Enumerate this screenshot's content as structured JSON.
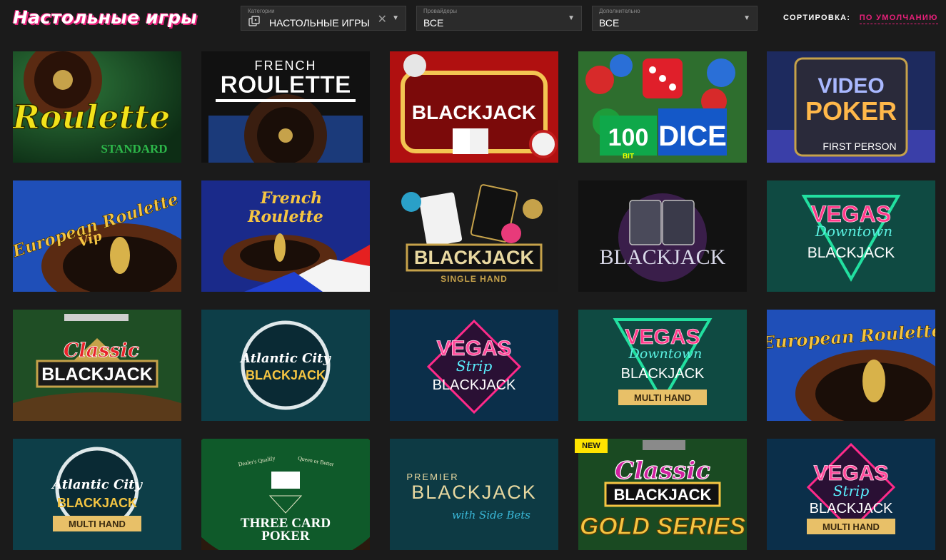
{
  "header": {
    "title": "Настольные игры",
    "filters": {
      "category": {
        "label": "Категории",
        "value": "НАСТОЛЬНЫЕ ИГРЫ",
        "icon": "table-game-icon"
      },
      "provider": {
        "label": "Провайдеры",
        "value": "ВСЕ"
      },
      "extra": {
        "label": "Дополнительно",
        "value": "ВСЕ"
      }
    },
    "sort": {
      "label": "СОРТИРОВКА:",
      "value": "ПО УМОЛЧАНИЮ"
    }
  },
  "games": [
    {
      "t1": "Roulette",
      "t2": "STANDARD"
    },
    {
      "t1": "FRENCH",
      "t2": "ROULETTE"
    },
    {
      "t1": "BLACKJACK",
      "t2": ""
    },
    {
      "t1": "100",
      "t2": "DICE",
      "t3": "BIT"
    },
    {
      "t1": "VIDEO",
      "t2": "POKER",
      "t3": "FIRST PERSON"
    },
    {
      "t1": "European Roulette",
      "t2": "Vip"
    },
    {
      "t1": "French",
      "t2": "Roulette"
    },
    {
      "t1": "BLACKJACK",
      "t2": "SINGLE HAND"
    },
    {
      "t1": "BLACKJACK",
      "t2": ""
    },
    {
      "t1": "VEGAS",
      "t2": "Downtown",
      "t3": "BLACKJACK"
    },
    {
      "t1": "Classic",
      "t2": "BLACKJACK"
    },
    {
      "t1": "Atlantic City",
      "t2": "BLACKJACK"
    },
    {
      "t1": "VEGAS",
      "t2": "Strip",
      "t3": "BLACKJACK"
    },
    {
      "t1": "VEGAS",
      "t2": "Downtown",
      "t3": "BLACKJACK",
      "t4": "MULTI HAND"
    },
    {
      "t1": "European Roulette",
      "t2": ""
    },
    {
      "t1": "Atlantic City",
      "t2": "BLACKJACK",
      "t4": "MULTI HAND"
    },
    {
      "t1": "THREE CARD",
      "t2": "POKER",
      "t3": "Dealer's Qualify",
      "t4": "Queen or Better"
    },
    {
      "t1": "PREMIER",
      "t2": "BLACKJACK",
      "t3": "with Side Bets"
    },
    {
      "t1": "Classic",
      "t2": "BLACKJACK",
      "t3": "GOLD SERIES",
      "badge": "NEW"
    },
    {
      "t1": "VEGAS",
      "t2": "Strip",
      "t3": "BLACKJACK",
      "t4": "MULTI HAND"
    }
  ],
  "colors": {
    "accent": "#e8207a",
    "badge": "#ffe400",
    "background": "#1b1b1b"
  }
}
